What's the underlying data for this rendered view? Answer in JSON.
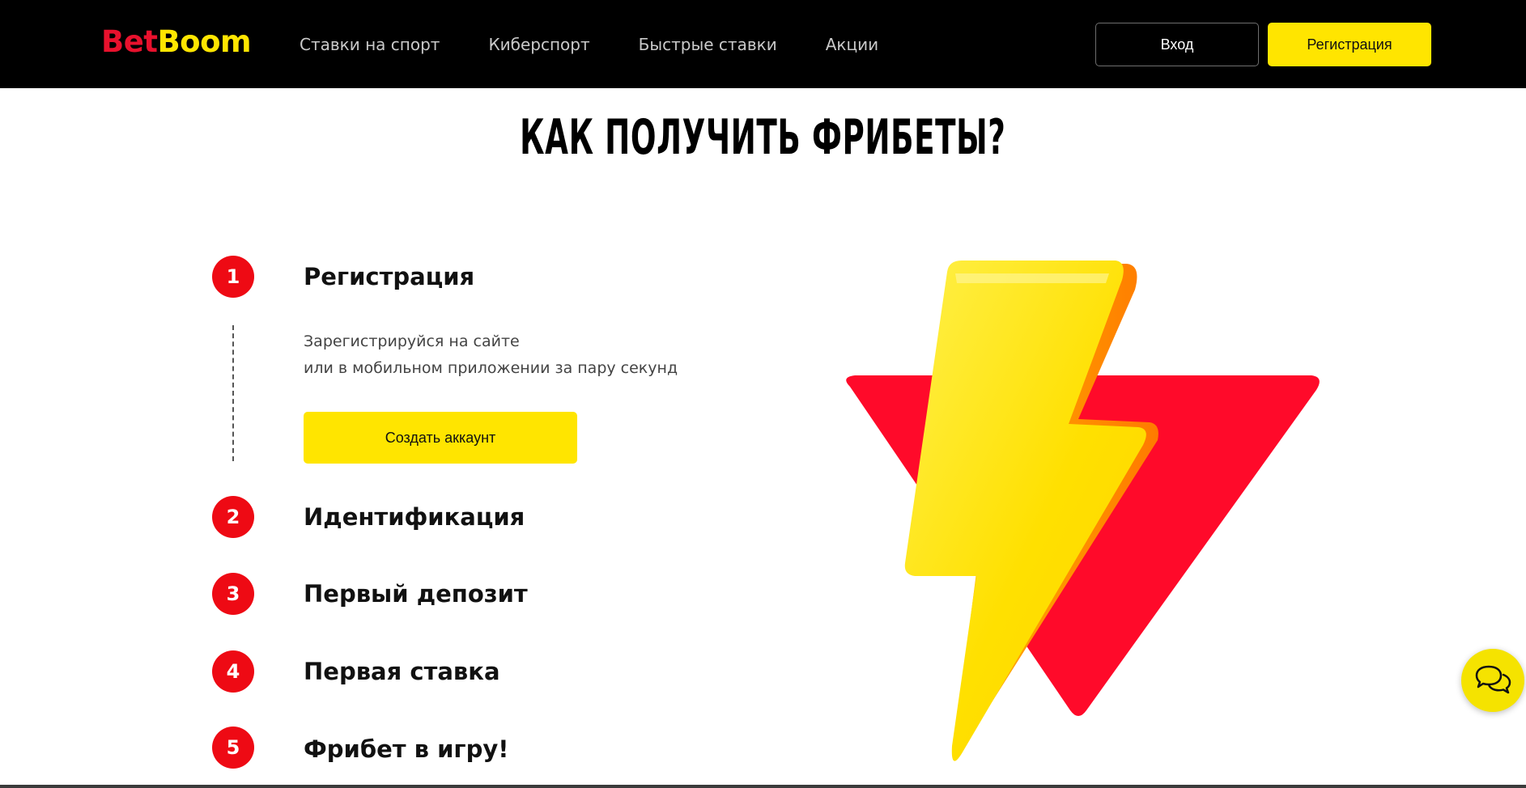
{
  "header": {
    "logo": {
      "part1": "Bet",
      "part2": "Boom"
    },
    "nav": [
      "Ставки на спорт",
      "Киберспорт",
      "Быстрые ставки",
      "Акции"
    ],
    "login_label": "Вход",
    "register_label": "Регистрация"
  },
  "main": {
    "title": "КАК ПОЛУЧИТЬ ФРИБЕТЫ?",
    "steps": [
      {
        "number": "1",
        "title": "Регистрация",
        "description_line1": "Зарегистрируйся на сайте",
        "description_line2": "или в мобильном приложении за пару секунд",
        "button_label": "Создать аккаунт"
      },
      {
        "number": "2",
        "title": "Идентификация"
      },
      {
        "number": "3",
        "title": "Первый депозит"
      },
      {
        "number": "4",
        "title": "Первая ставка"
      },
      {
        "number": "5",
        "title": "Фрибет в игру!"
      }
    ]
  },
  "colors": {
    "header_bg": "#000000",
    "brand_red": "#e8112d",
    "brand_yellow": "#ffe500",
    "step_badge": "#ee0a14"
  },
  "icons": {
    "illustration": "lightning-triangle-illustration",
    "chat": "chat-bubbles-icon"
  }
}
